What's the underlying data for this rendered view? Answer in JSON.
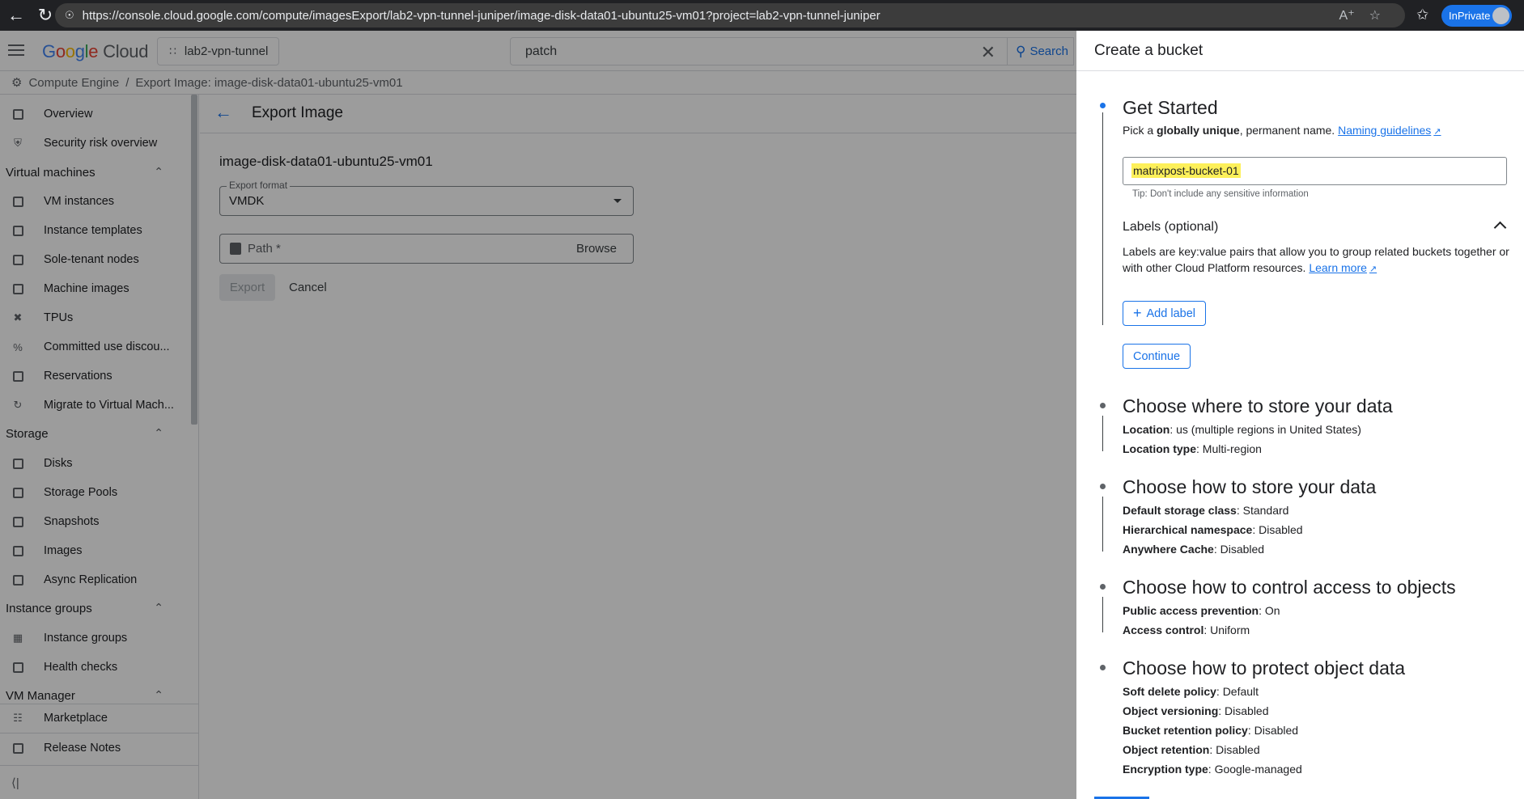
{
  "browser": {
    "url": "https://console.cloud.google.com/compute/imagesExport/lab2-vpn-tunnel-juniper/image-disk-data01-ubuntu25-vm01?project=lab2-vpn-tunnel-juniper",
    "inprivate_label": "InPrivate"
  },
  "header": {
    "logo_google": [
      "G",
      "o",
      "o",
      "g",
      "l",
      "e"
    ],
    "logo_cloud": "Cloud",
    "project": "lab2-vpn-tunnel",
    "search_value": "patch",
    "search_button": "Search"
  },
  "breadcrumb": {
    "root": "Compute Engine",
    "separator": "/",
    "current": "Export Image: image-disk-data01-ubuntu25-vm01"
  },
  "sidebar": {
    "top_items": [
      {
        "label": "Overview",
        "icon": "overview-icon"
      },
      {
        "label": "Security risk overview",
        "icon": "shield-icon"
      }
    ],
    "sections": [
      {
        "title": "Virtual machines",
        "items": [
          {
            "label": "VM instances",
            "icon": "vm-icon"
          },
          {
            "label": "Instance templates",
            "icon": "template-icon"
          },
          {
            "label": "Sole-tenant nodes",
            "icon": "node-icon"
          },
          {
            "label": "Machine images",
            "icon": "machine-image-icon"
          },
          {
            "label": "TPUs",
            "icon": "tpu-icon"
          },
          {
            "label": "Committed use discou...",
            "icon": "percent-icon"
          },
          {
            "label": "Reservations",
            "icon": "calendar-icon"
          },
          {
            "label": "Migrate to Virtual Mach...",
            "icon": "migrate-icon"
          }
        ]
      },
      {
        "title": "Storage",
        "items": [
          {
            "label": "Disks",
            "icon": "disk-icon"
          },
          {
            "label": "Storage Pools",
            "icon": "storage-pool-icon"
          },
          {
            "label": "Snapshots",
            "icon": "snapshot-icon"
          },
          {
            "label": "Images",
            "icon": "images-icon"
          },
          {
            "label": "Async Replication",
            "icon": "replication-icon"
          }
        ]
      },
      {
        "title": "Instance groups",
        "items": [
          {
            "label": "Instance groups",
            "icon": "group-icon"
          },
          {
            "label": "Health checks",
            "icon": "health-icon"
          }
        ]
      },
      {
        "title": "VM Manager",
        "items": []
      }
    ],
    "footer_items": [
      {
        "label": "Marketplace",
        "icon": "marketplace-icon"
      },
      {
        "label": "Release Notes",
        "icon": "notes-icon"
      }
    ]
  },
  "main": {
    "title": "Export Image",
    "image_name": "image-disk-data01-ubuntu25-vm01",
    "export_format_label": "Export format",
    "export_format_value": "VMDK",
    "path_placeholder": "Path *",
    "browse": "Browse",
    "export_button": "Export",
    "cancel_button": "Cancel"
  },
  "panel": {
    "title": "Create a bucket",
    "get_started": {
      "title": "Get Started",
      "desc_prefix": "Pick a ",
      "desc_bold": "globally unique",
      "desc_suffix": ", permanent name.",
      "naming_link": "Naming guidelines",
      "name_value": "matrixpost-bucket-01",
      "tip": "Tip: Don't include any sensitive information",
      "labels_title": "Labels (optional)",
      "labels_desc": "Labels are key:value pairs that allow you to group related buckets together or with other Cloud Platform resources.",
      "learn_more": "Learn more",
      "add_label": "Add label",
      "continue": "Continue"
    },
    "store_where": {
      "title": "Choose where to store your data",
      "rows": [
        {
          "k": "Location",
          "v": ": us (multiple regions in United States)"
        },
        {
          "k": "Location type",
          "v": ": Multi-region"
        }
      ]
    },
    "store_how": {
      "title": "Choose how to store your data",
      "rows": [
        {
          "k": "Default storage class",
          "v": ": Standard"
        },
        {
          "k": "Hierarchical namespace",
          "v": ": Disabled"
        },
        {
          "k": "Anywhere Cache",
          "v": ": Disabled"
        }
      ]
    },
    "access": {
      "title": "Choose how to control access to objects",
      "rows": [
        {
          "k": "Public access prevention",
          "v": ": On"
        },
        {
          "k": "Access control",
          "v": ": Uniform"
        }
      ]
    },
    "protect": {
      "title": "Choose how to protect object data",
      "rows": [
        {
          "k": "Soft delete policy",
          "v": ": Default"
        },
        {
          "k": "Object versioning",
          "v": ": Disabled"
        },
        {
          "k": "Bucket retention policy",
          "v": ": Disabled"
        },
        {
          "k": "Object retention",
          "v": ": Disabled"
        },
        {
          "k": "Encryption type",
          "v": ": Google-managed"
        }
      ]
    }
  }
}
